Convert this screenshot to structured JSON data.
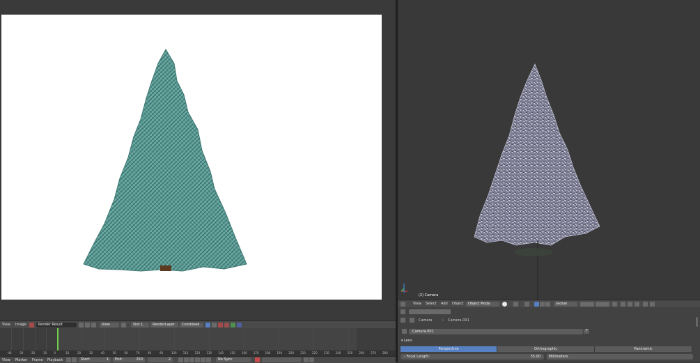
{
  "image_editor": {
    "menus": [
      "View",
      "Image"
    ],
    "image_name": "Render Result",
    "view_label": "View",
    "slot": "Slot 1",
    "render_layer": "RenderLayer",
    "pass": "Combined"
  },
  "timeline": {
    "ruler_ticks": [
      "-40",
      "-30",
      "-20",
      "-10",
      "0",
      "10",
      "20",
      "30",
      "40",
      "50",
      "60",
      "70",
      "80",
      "90",
      "100",
      "110",
      "120",
      "130",
      "140",
      "150",
      "160",
      "170",
      "180",
      "190",
      "200",
      "210",
      "220",
      "230",
      "240",
      "250",
      "260",
      "270",
      "280"
    ],
    "menus": [
      "View",
      "Marker",
      "Frame",
      "Playback"
    ],
    "start_label": "Start:",
    "start_value": "1",
    "end_label": "End:",
    "end_value": "250",
    "current_frame": "2",
    "sync": "No Sync"
  },
  "viewport": {
    "object_label": "(2) Camera",
    "menus": [
      "View",
      "Select",
      "Add",
      "Object"
    ],
    "mode": "Object Mode",
    "orientation": "Global"
  },
  "properties": {
    "breadcrumb_object": "Camera",
    "breadcrumb_data": "Camera.001",
    "datablock_name": "Camera.001",
    "datablock_f": "F",
    "panel_title": "Lens",
    "lens_tabs": [
      "Perspective",
      "Orthographic",
      "Panoramic"
    ],
    "active_tab": 0,
    "focal_label": "Focal Length:",
    "focal_value": "35.00",
    "units": "Millimeters"
  },
  "colors": {
    "tree_render": "#4f8f8a",
    "tree_viewport": "#8a8aa6",
    "accent": "#5680c2",
    "playhead": "#6fcf4a"
  }
}
